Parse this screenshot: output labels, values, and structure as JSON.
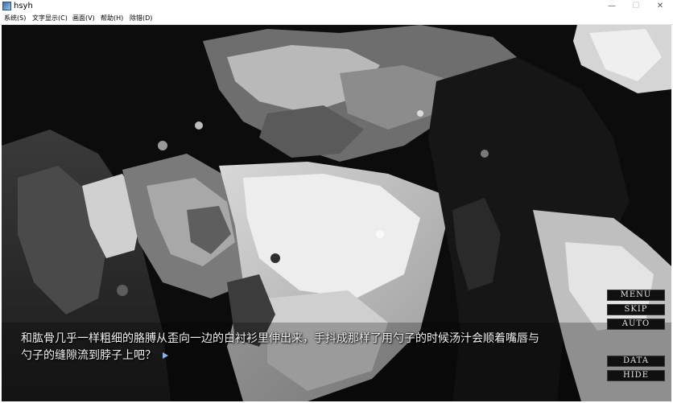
{
  "window": {
    "title": "hsyh",
    "min_glyph": "—",
    "max_glyph": "☐",
    "close_glyph": "✕"
  },
  "menu": {
    "items": [
      {
        "label": "系统(S)"
      },
      {
        "label": "文字显示(C)"
      },
      {
        "label": "画面(V)"
      },
      {
        "label": "帮助(H)"
      },
      {
        "label": "除错(D)"
      }
    ]
  },
  "dialogue": {
    "line1": "和肱骨几乎一样粗细的胳膊从歪向一边的白衬衫里伸出来，手抖成那样了用勺子的时候汤汁会顺着嘴唇与",
    "line2": "勺子的缝隙流到脖子上吧？"
  },
  "game_menu": {
    "menu_label": "MENU",
    "skip_label": "SKIP",
    "auto_label": "AUTO",
    "data_label": "DATA",
    "hide_label": "HIDE"
  },
  "icons": {
    "app": "app-icon",
    "next": "next-page-arrow-icon"
  },
  "colors": {
    "scene_base": "#0a0a0a",
    "text": "#f2f2f2",
    "arrow": "#8fb2e0"
  }
}
